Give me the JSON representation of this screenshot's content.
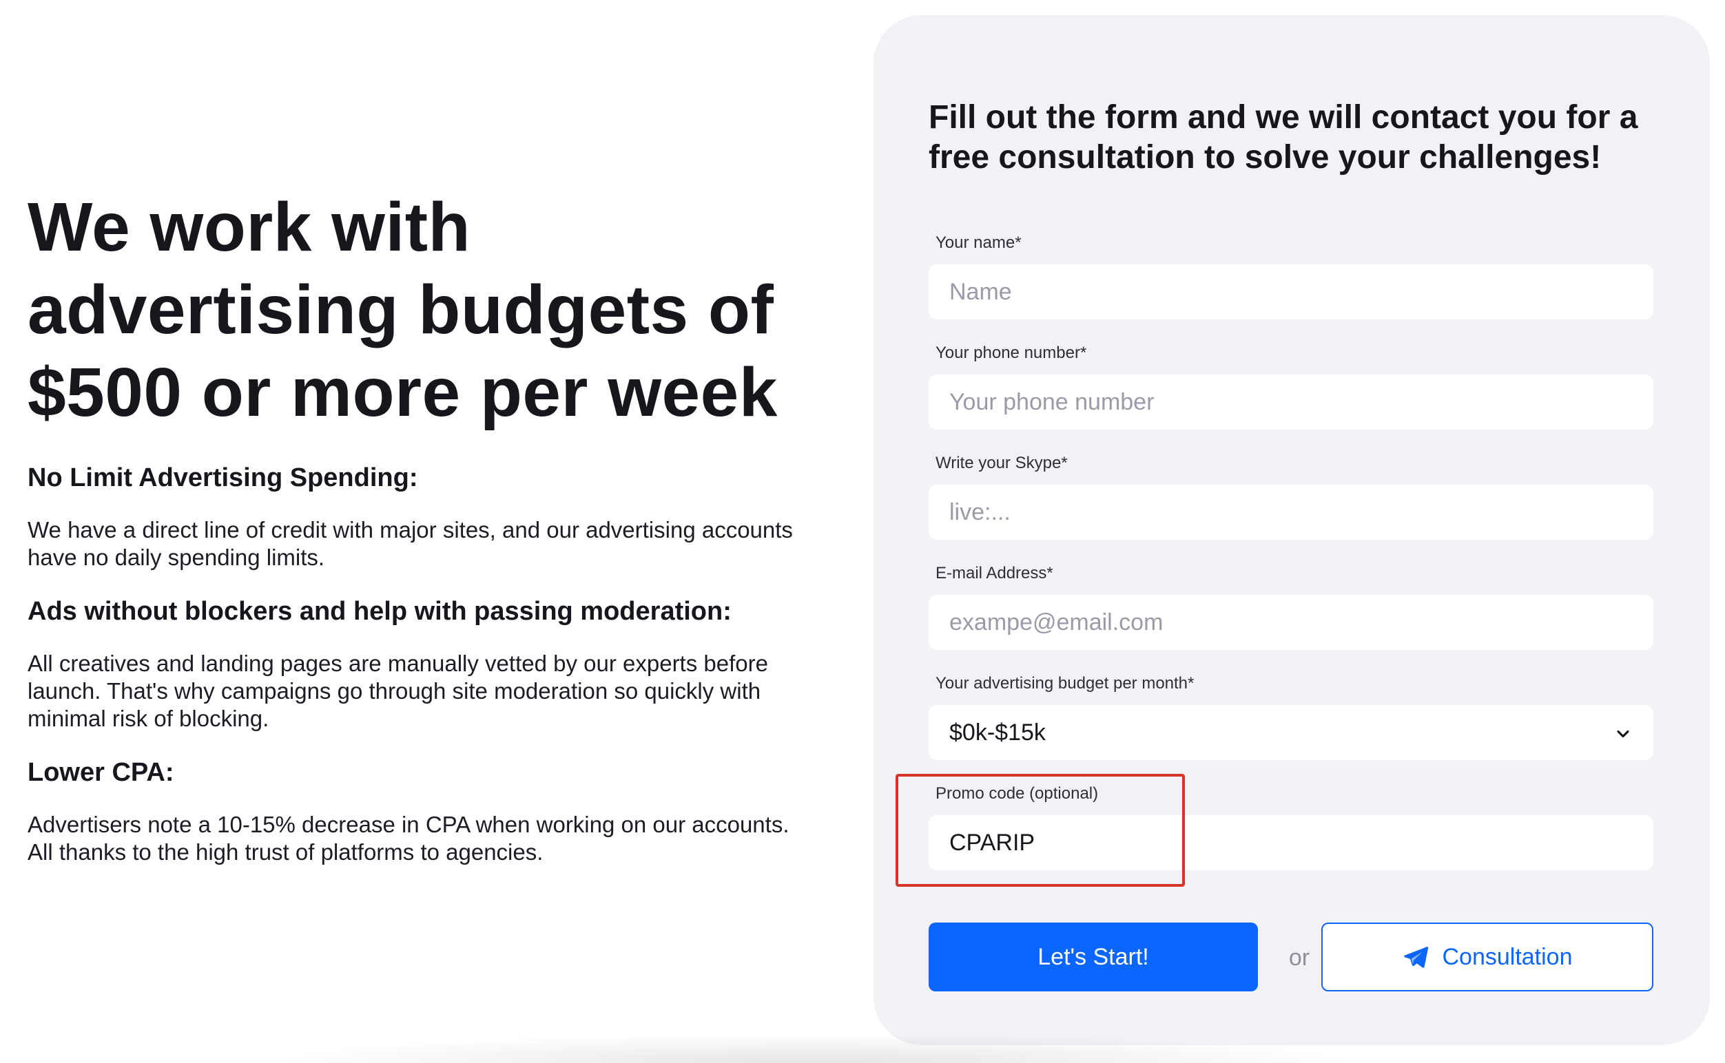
{
  "left": {
    "headline": "We work with advertising budgets of $500 or more per week",
    "features": [
      {
        "title": "No Limit Advertising Spending:",
        "text": "We have a direct line of credit with major sites, and our advertising accounts have no daily spending limits."
      },
      {
        "title": "Ads without blockers and help with passing moderation:",
        "text": "All creatives and landing pages are manually vetted by our experts before launch. That's why campaigns go through site moderation so quickly with minimal risk of blocking."
      },
      {
        "title": "Lower CPA:",
        "text": "Advertisers note a 10-15% decrease in CPA when working on our accounts. All thanks to the high trust of platforms to agencies."
      }
    ]
  },
  "form": {
    "title": "Fill out the form and we will contact you for a free consultation to solve your challenges!",
    "name": {
      "label": "Your name*",
      "placeholder": "Name",
      "value": ""
    },
    "phone": {
      "label": "Your phone number*",
      "placeholder": "Your phone number",
      "value": ""
    },
    "skype": {
      "label": "Write your Skype*",
      "placeholder": "live:...",
      "value": ""
    },
    "email": {
      "label": "E-mail Address*",
      "placeholder": "exampe@email.com",
      "value": ""
    },
    "budget": {
      "label": "Your advertising budget per month*",
      "selected": "$0k-$15k"
    },
    "promo": {
      "label": "Promo code (optional)",
      "value": "CPARIP"
    },
    "start_button": "Let's Start!",
    "or_text": "or",
    "consult_button": "Consultation"
  },
  "colors": {
    "accent": "#0a66ff",
    "panel_bg": "#f2f2f6",
    "highlight": "#d9342b"
  },
  "icons": {
    "select_chevron": "chevron-down-icon",
    "consult": "telegram-icon"
  }
}
